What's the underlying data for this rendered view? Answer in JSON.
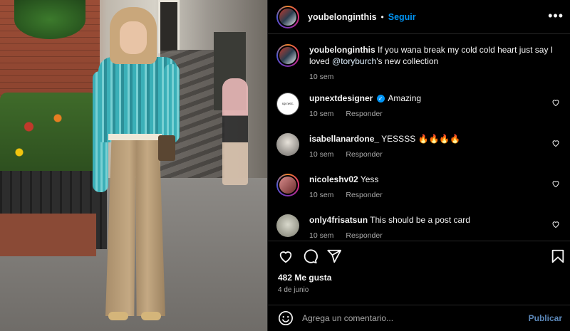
{
  "post": {
    "username": "youbelonginthis",
    "follow_label": "Seguir",
    "more_icon": "more-options-icon",
    "caption_user": "youbelonginthis",
    "caption_text_before": "If you wana break my cold cold heart just say I loved ",
    "caption_mention": "@toryburch",
    "caption_text_after": "'s new collection",
    "caption_time": "10 sem",
    "likes": "482 Me gusta",
    "date": "4 de junio"
  },
  "comments": [
    {
      "user": "upnextdesigner",
      "verified": true,
      "text": "Amazing",
      "time": "10 sem",
      "reply": "Responder"
    },
    {
      "user": "isabellanardone_",
      "verified": false,
      "text": "YESSSS 🔥🔥🔥🔥",
      "time": "10 sem",
      "reply": "Responder"
    },
    {
      "user": "nicoleshv02",
      "verified": false,
      "text": "Yess",
      "time": "10 sem",
      "reply": "Responder"
    },
    {
      "user": "only4frisatsun",
      "verified": false,
      "text": "This should be a post card",
      "time": "10 sem",
      "reply": "Responder"
    }
  ],
  "avatars": {
    "upnextdesigner_text": "up next."
  },
  "composer": {
    "placeholder": "Agrega un comentario...",
    "publish_label": "Publicar",
    "emoji_icon": "emoji-icon"
  },
  "colors": {
    "link_blue": "#0095f6",
    "muted": "#a8a8a8",
    "background": "#000000"
  }
}
